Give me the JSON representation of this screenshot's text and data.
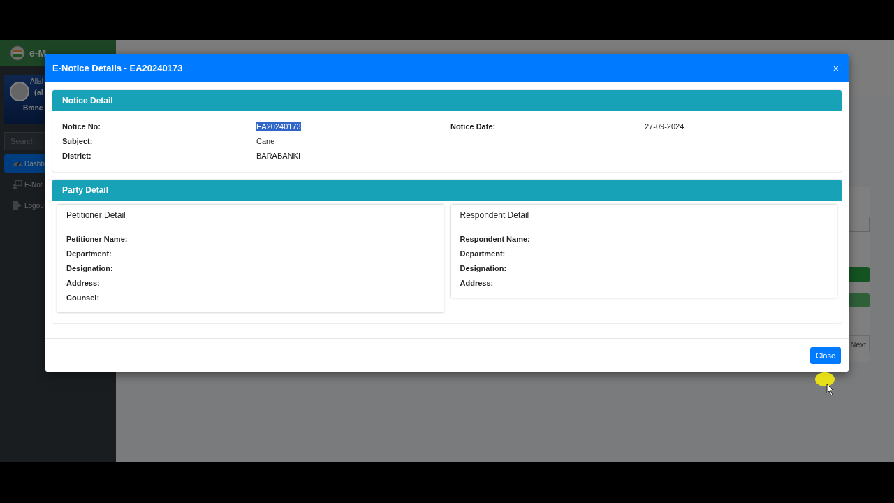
{
  "background": {
    "brand": "e-M",
    "user": {
      "name": "Allal",
      "login": "(al",
      "branch": "Branc"
    },
    "search": {
      "placeholder": "Search"
    },
    "nav": [
      {
        "label": "Dashb",
        "kind": "gauge",
        "selected": true
      },
      {
        "label": "E-Not",
        "kind": "notice",
        "selected": false
      },
      {
        "label": "Logou",
        "kind": "logout",
        "selected": false
      }
    ],
    "pager_next": "Next"
  },
  "modal": {
    "title": "E-Notice Details - EA20240173",
    "close_icon": "×",
    "notice": {
      "title": "Notice Detail",
      "rows": [
        {
          "fields": [
            {
              "label": "Notice No:",
              "value": "EA20240173",
              "selected": true
            },
            {
              "label": "Notice Date:",
              "value": "27-09-2024",
              "selected": false
            }
          ]
        },
        {
          "fields": [
            {
              "label": "Subject:",
              "value": "Cane",
              "selected": false
            }
          ]
        },
        {
          "fields": [
            {
              "label": "District:",
              "value": "BARABANKI",
              "selected": false
            }
          ]
        }
      ]
    },
    "party": {
      "title": "Party Detail",
      "panels": [
        {
          "title": "Petitioner Detail",
          "fields": [
            "Petitioner Name:",
            "Department:",
            "Designation:",
            "Address:",
            "Counsel:"
          ]
        },
        {
          "title": "Respondent Detail",
          "fields": [
            "Respondent Name:",
            "Department:",
            "Designation:",
            "Address:"
          ]
        }
      ]
    },
    "footer_button": "Close"
  }
}
